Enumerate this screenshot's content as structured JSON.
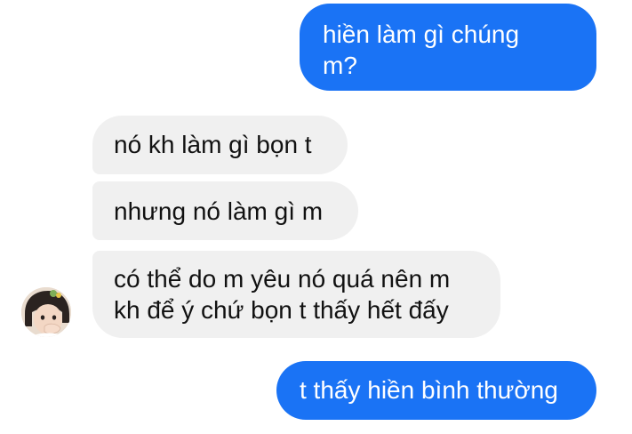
{
  "colors": {
    "outgoing_bubble": "#1a73f5",
    "incoming_bubble": "#f0f0f0",
    "background": "#ffffff"
  },
  "conversation": {
    "messages": [
      {
        "direction": "outgoing",
        "lines": [
          "hiền làm gì chúng",
          "m?"
        ]
      },
      {
        "direction": "incoming",
        "lines": [
          "nó kh làm gì bọn t"
        ]
      },
      {
        "direction": "incoming",
        "lines": [
          "nhưng nó làm gì m"
        ]
      },
      {
        "direction": "incoming",
        "lines": [
          "có thể do m yêu nó quá nên m",
          "kh để ý chứ bọn t thấy hết đấy"
        ]
      },
      {
        "direction": "outgoing",
        "lines": [
          "t thấy hiền bình thường"
        ]
      }
    ]
  },
  "contact": {
    "avatar_icon": "user-avatar-photo"
  }
}
